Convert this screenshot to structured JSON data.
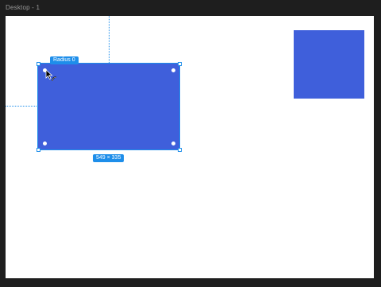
{
  "canvas": {
    "frame_label": "Desktop - 1",
    "background": "#ffffff",
    "app_background": "#1e1e1e"
  },
  "selection": {
    "radius_badge": "Radius 0",
    "size_badge": "549 × 335",
    "fill_color": "#3f5fdb",
    "selection_color": "#1e8eea"
  },
  "shapes": {
    "second_rectangle_color": "#3f5fdb"
  },
  "cursor": {
    "icon": "corner-radius-cursor-icon"
  }
}
